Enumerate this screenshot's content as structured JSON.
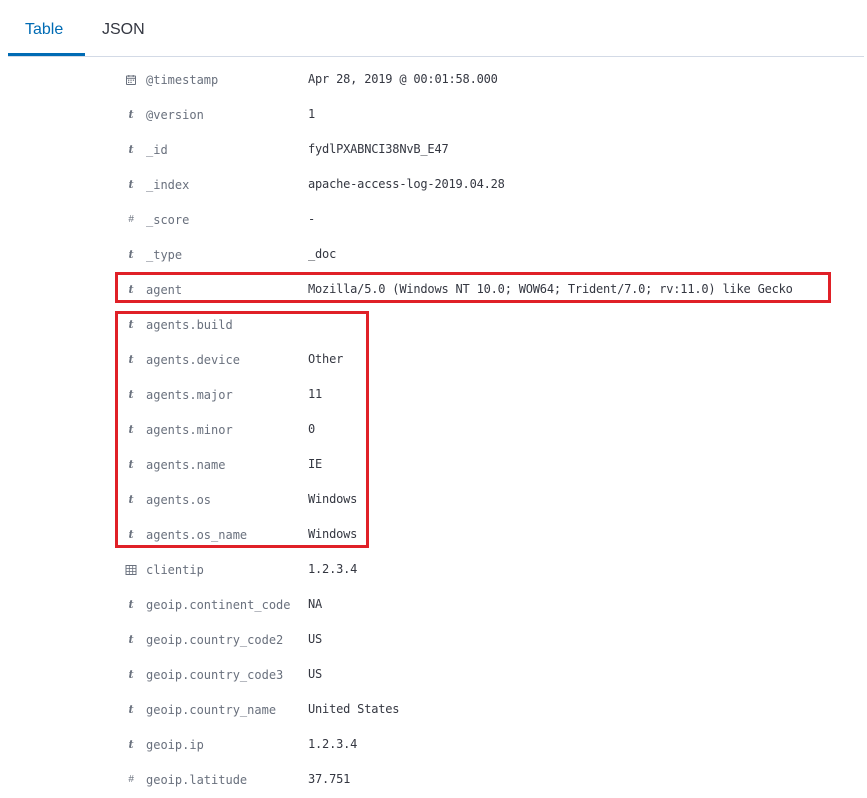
{
  "tabs": [
    {
      "label": "Table",
      "active": true
    },
    {
      "label": "JSON",
      "active": false
    }
  ],
  "fields": [
    {
      "type": "date",
      "name": "@timestamp",
      "value": "Apr 28, 2019 @ 00:01:58.000"
    },
    {
      "type": "string",
      "name": "@version",
      "value": "1"
    },
    {
      "type": "string",
      "name": "_id",
      "value": "fydlPXABNCI38NvB_E47"
    },
    {
      "type": "string",
      "name": "_index",
      "value": "apache-access-log-2019.04.28"
    },
    {
      "type": "number",
      "name": "_score",
      "value": " -"
    },
    {
      "type": "string",
      "name": "_type",
      "value": "_doc"
    },
    {
      "type": "string",
      "name": "agent",
      "value": "Mozilla/5.0 (Windows NT 10.0; WOW64; Trident/7.0; rv:11.0) like Gecko"
    },
    {
      "type": "string",
      "name": "agents.build",
      "value": ""
    },
    {
      "type": "string",
      "name": "agents.device",
      "value": "Other"
    },
    {
      "type": "string",
      "name": "agents.major",
      "value": "11"
    },
    {
      "type": "string",
      "name": "agents.minor",
      "value": "0"
    },
    {
      "type": "string",
      "name": "agents.name",
      "value": "IE"
    },
    {
      "type": "string",
      "name": "agents.os",
      "value": "Windows"
    },
    {
      "type": "string",
      "name": "agents.os_name",
      "value": "Windows"
    },
    {
      "type": "ip",
      "name": "clientip",
      "value": "1.2.3.4"
    },
    {
      "type": "string",
      "name": "geoip.continent_code",
      "value": "NA"
    },
    {
      "type": "string",
      "name": "geoip.country_code2",
      "value": "US"
    },
    {
      "type": "string",
      "name": "geoip.country_code3",
      "value": "US"
    },
    {
      "type": "string",
      "name": "geoip.country_name",
      "value": "United States"
    },
    {
      "type": "string",
      "name": "geoip.ip",
      "value": "1.2.3.4"
    },
    {
      "type": "number",
      "name": "geoip.latitude",
      "value": "37.751"
    }
  ],
  "icons": {
    "string": "t",
    "number": "#"
  },
  "colors": {
    "accent": "#006bb4",
    "highlight": "#e02027",
    "field_name": "#69707d",
    "field_value": "#343741"
  }
}
